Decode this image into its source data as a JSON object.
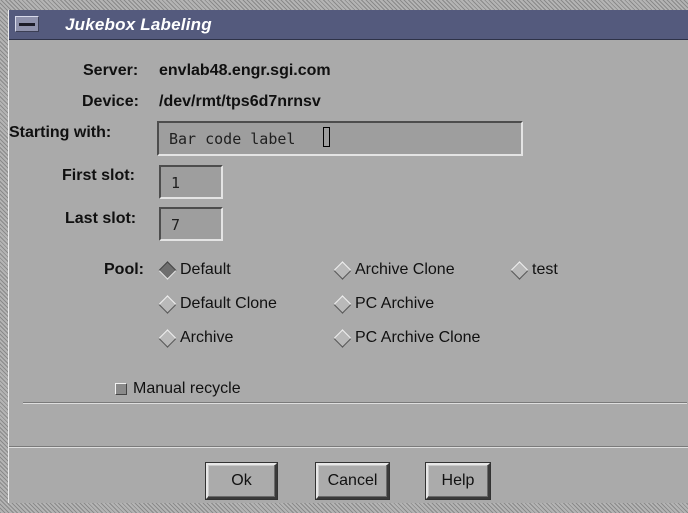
{
  "window": {
    "title": "Jukebox Labeling"
  },
  "fields": {
    "server_label": "Server:",
    "server_value": "envlab48.engr.sgi.com",
    "device_label": "Device:",
    "device_value": "/dev/rmt/tps6d7nrnsv",
    "starting_label": "Starting with:",
    "starting_value": "Bar code label",
    "first_slot_label": "First slot:",
    "first_slot_value": "1",
    "last_slot_label": "Last slot:",
    "last_slot_value": "7"
  },
  "pool": {
    "label": "Pool:",
    "selected": "Default",
    "options": [
      "Default",
      "Archive Clone",
      "test",
      "Default Clone",
      "PC Archive",
      "Archive",
      "PC Archive Clone"
    ]
  },
  "manual_recycle": {
    "label": "Manual recycle",
    "checked": false
  },
  "buttons": {
    "ok": "Ok",
    "cancel": "Cancel",
    "help": "Help"
  },
  "colors": {
    "window_bg": "#aaaaaa",
    "titlebar": "#545a7d",
    "title_text": "#ffffff"
  }
}
